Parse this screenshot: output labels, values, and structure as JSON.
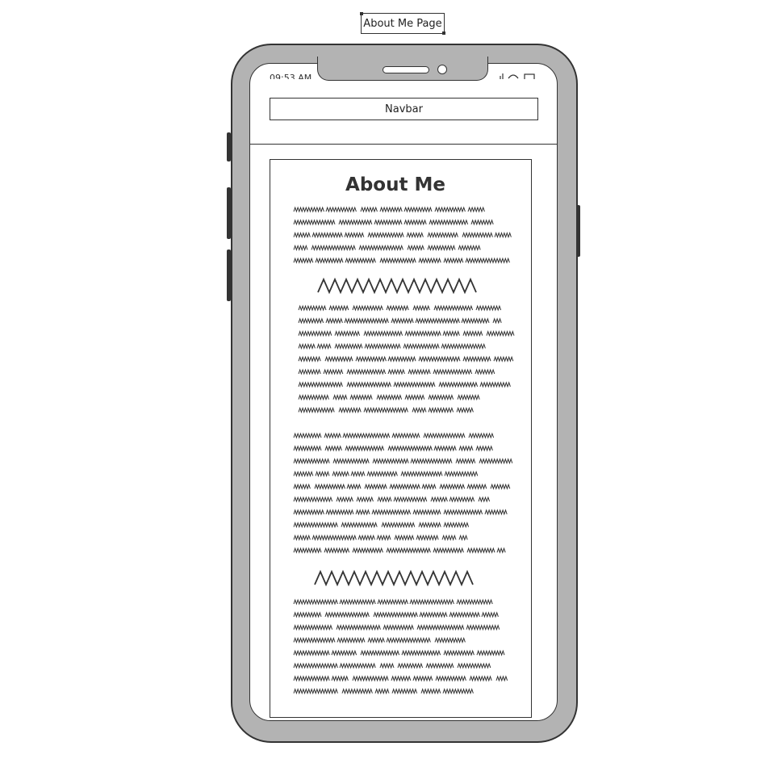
{
  "page_label": "About Me Page",
  "status_bar": {
    "time": "09:53 AM"
  },
  "navbar": {
    "label": "Navbar"
  },
  "content": {
    "title": "About Me"
  },
  "colors": {
    "device_body": "#b3b3b3",
    "outline": "#333333",
    "screen": "#ffffff"
  }
}
